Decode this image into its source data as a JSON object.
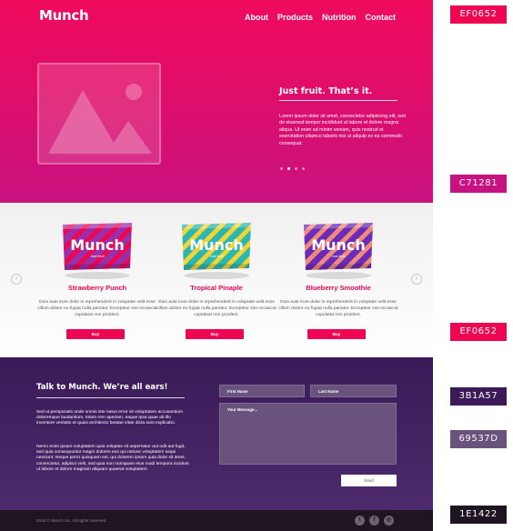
{
  "header": {
    "logo": "Munch",
    "nav": [
      "About",
      "Products",
      "Nutrition",
      "Contact"
    ]
  },
  "hero": {
    "title": "Just fruit. That’s it.",
    "text": "Lorem ipsum dolor sit amet, consectetur adipiscing elit, sed do eiusmod tempor incididunt ut labore et dolore magna aliqua. Ut enim ad minim veniam, quis nostrud et exercitation ullamco laboris nisi ut aliquip ex ea commodo consequat.",
    "slide_count": 4,
    "active_slide": 2
  },
  "products": {
    "prev_arrow": "‹",
    "next_arrow": "›",
    "items": [
      {
        "name": "Strawberry Punch",
        "description": "Duis aute irure dolor in reprehenderit in voluptate velit esse cillum dolore eu fugiat nulla pariatur. Excepteur sint occaecat cupidatat non proident.",
        "button": "Buy",
        "bag_label": "Munch",
        "bag_sub": "Just fruit"
      },
      {
        "name": "Tropical Pinaple",
        "description": "Duis aute irure dolor in reprehenderit in voluptate velit esse cillum dolore eu fugiat nulla pariatur. Excepteur sint occaecat cupidatat non proident.",
        "button": "Buy",
        "bag_label": "Munch",
        "bag_sub": "Just fruit"
      },
      {
        "name": "Blueberry Smoothie",
        "description": "Duis aute irure dolor in reprehenderit in voluptate velit esse cillum dolore eu fugiat nulla pariatur. Excepteur sint occaecat cupidatat non proident.",
        "button": "Buy",
        "bag_label": "Munch",
        "bag_sub": "Just fruit"
      }
    ]
  },
  "contact": {
    "title": "Talk to Munch. We’re all ears!",
    "text1": "Sed ut perspiciatis unde omnis iste natus error sit voluptatem accusantium doloremque laudantium, totam rem aperiam, eaque ipsa quae ab illo inventore veritatis et quasi architecto beatae vitae dicta sunt explicabo.",
    "text2": "Nemo enim ipsam voluptatem quia voluptas sit aspernatur aut odit aut fugit, sed quia consequuntur magni dolores eos qui ratione voluptatem sequi nesciunt. Neque porro quisquam est, qui dolorem ipsum quia dolor sit amet, consectetur, adipisci velit, sed quia non numquam eius modi tempora incidunt ut labore et dolore magnam aliquam quaerat voluptatem.",
    "first_name_placeholder": "First Name",
    "last_name_placeholder": "Last Name",
    "message_placeholder": "Your Message...",
    "send_label": "Send"
  },
  "footer": {
    "copyright": "2016 © Munch Inc. All rights reserved.",
    "social": [
      "twitter-icon",
      "facebook-icon",
      "instagram-icon"
    ]
  },
  "palette": [
    {
      "label": "EF0652",
      "color": "#ef0652"
    },
    {
      "label": "C71281",
      "color": "#c71281"
    },
    {
      "label": "EF0652",
      "color": "#ef0652"
    },
    {
      "label": "3B1A57",
      "color": "#3b1a57"
    },
    {
      "label": "69537D",
      "color": "#69537d"
    },
    {
      "label": "1E1422",
      "color": "#1e1422"
    }
  ],
  "colors": {
    "brand_pink": "#ef0652",
    "hero_magenta": "#c71281",
    "contact_purple": "#3b1a57",
    "field_purple": "#69537d",
    "footer_dark": "#1e1422"
  }
}
